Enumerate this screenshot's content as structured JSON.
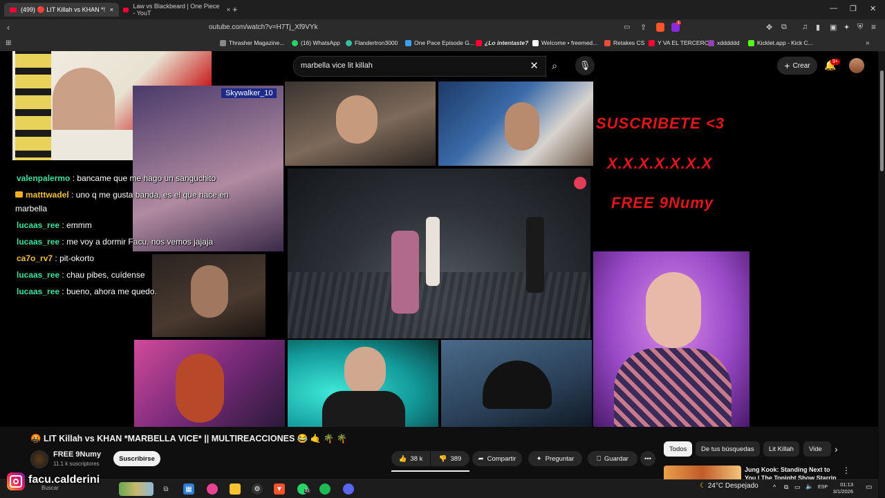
{
  "browser": {
    "tabs": [
      {
        "label": "(499) 🔴 LIT Killah vs KHAN *!",
        "active": true
      },
      {
        "label": "Law vs Blackbeard | One Piece - YouT",
        "active": false
      }
    ],
    "new_tab_icon": "plus-icon",
    "url": "outube.com/watch?v=H7Tj_Xf9VYk",
    "extension_badge": "1",
    "bookmarks": [
      {
        "label": "Thrasher Magazine...",
        "color": "#888888"
      },
      {
        "label": "(16) WhatsApp",
        "color": "#25d366"
      },
      {
        "label": "Flandertron3000",
        "color": "#35c1a0"
      },
      {
        "label": "One Pace Episode G...",
        "color": "#3aa0ff"
      },
      {
        "label": "¿Lo intentaste?",
        "color": "#ff0033"
      },
      {
        "label": "Welcome • freemed...",
        "color": "#ffffff"
      },
      {
        "label": "Retakes CS",
        "color": "#e74c3c"
      },
      {
        "label": "Y VA EL TERCERO",
        "color": "#ff0033"
      },
      {
        "label": "xdddddd",
        "color": "#8e44ad"
      },
      {
        "label": "Kicklet.app - Kick C...",
        "color": "#53fc18"
      }
    ]
  },
  "youtube": {
    "search_query": "marbella vice lit killah",
    "create_label": "Crear",
    "notification_count": "9+"
  },
  "overlay": {
    "text_lines": [
      "SUSCRIBETE <3",
      "X.X.X.X.X.X.X",
      "FREE 9Numy"
    ],
    "overlay_color": "#e0161b",
    "streamer_tag": "Skywalker_10"
  },
  "chat": [
    {
      "user": "valenpalermo",
      "message": "bancame que me hago un sanguchito",
      "color": "#3fe0a0"
    },
    {
      "user": "matttwadel",
      "message": "uno q me gusta banda, es el que hace en",
      "color": "#f0c040",
      "badge": true
    },
    {
      "user": "",
      "message": "marbella",
      "color": "#ffffff"
    },
    {
      "user": "lucaas_ree",
      "message": "emmm",
      "color": "#3fe0a0"
    },
    {
      "user": "lucaas_ree",
      "message": "me voy a dormir Facu, nos vemos jajaja",
      "color": "#3fe0a0"
    },
    {
      "user": "ca7o_rv7",
      "message": "pit-okorto",
      "color": "#f0c040"
    },
    {
      "user": "lucaas_ree",
      "message": "chau pibes, cuídense",
      "color": "#3fe0a0"
    },
    {
      "user": "lucaas_ree",
      "message": "bueno, ahora me quedo.",
      "color": "#3fe0a0"
    }
  ],
  "video": {
    "title": "🤬 LIT Killah vs KHAN *MARBELLA VICE* || MULTIREACCIONES 😂 🤙 🌴 🌴",
    "channel_name": "FREE 9Numy",
    "channel_subs": "11.1 k suscriptores",
    "subscribe_label": "Suscribirse",
    "likes": "38 k",
    "dislikes": "389",
    "share_label": "Compartir",
    "ask_label": "Preguntar",
    "save_label": "Guardar"
  },
  "chips": [
    "Todos",
    "De tus búsquedas",
    "Lit Killah",
    "Vide"
  ],
  "recommendation": {
    "title": "Jung Kook: Standing Next to You | The Tonight Show Starrin"
  },
  "watermark": {
    "handle": "facu.calderini"
  },
  "taskbar": {
    "search_label": "Buscar",
    "whatsapp_badge": "91",
    "temperature": "24°C",
    "weather": "Despejado",
    "lang": "ESP",
    "time": "01:13",
    "date": "3/1/2026"
  }
}
